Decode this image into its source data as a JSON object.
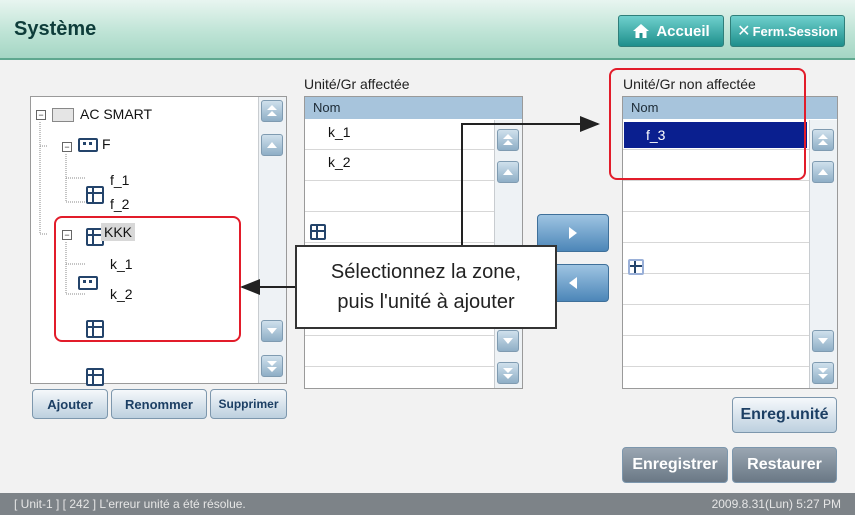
{
  "header": {
    "title": "Système",
    "home_label": "Accueil",
    "logout_label": "Ferm.Session"
  },
  "tree": {
    "root": "AC SMART",
    "zone_f": "F",
    "f_1": "f_1",
    "f_2": "f_2",
    "zone_kkk": "KKK",
    "k_1": "k_1",
    "k_2": "k_2"
  },
  "tree_buttons": {
    "add": "Ajouter",
    "rename": "Renommer",
    "delete": "Supprimer"
  },
  "assigned": {
    "title": "Unité/Gr affectée",
    "column": "Nom",
    "rows": [
      "k_1",
      "k_2"
    ]
  },
  "unassigned": {
    "title": "Unité/Gr non affectée",
    "column": "Nom",
    "rows": [
      "f_3"
    ]
  },
  "callout": {
    "line1": "Sélectionnez la zone,",
    "line2": "puis l'unité à ajouter"
  },
  "buttons": {
    "save_unit": "Enreg.unité",
    "save": "Enregistrer",
    "restore": "Restaurer"
  },
  "status": {
    "message": "[ Unit-1 ] [ 242 ] L'erreur unité a été résolue.",
    "datetime": "2009.8.31(Lun)  5:27 PM"
  },
  "colors": {
    "highlight_red": "#e21c2a",
    "selected_row": "#0a1f8f",
    "header_green": "#bfe4d6"
  }
}
